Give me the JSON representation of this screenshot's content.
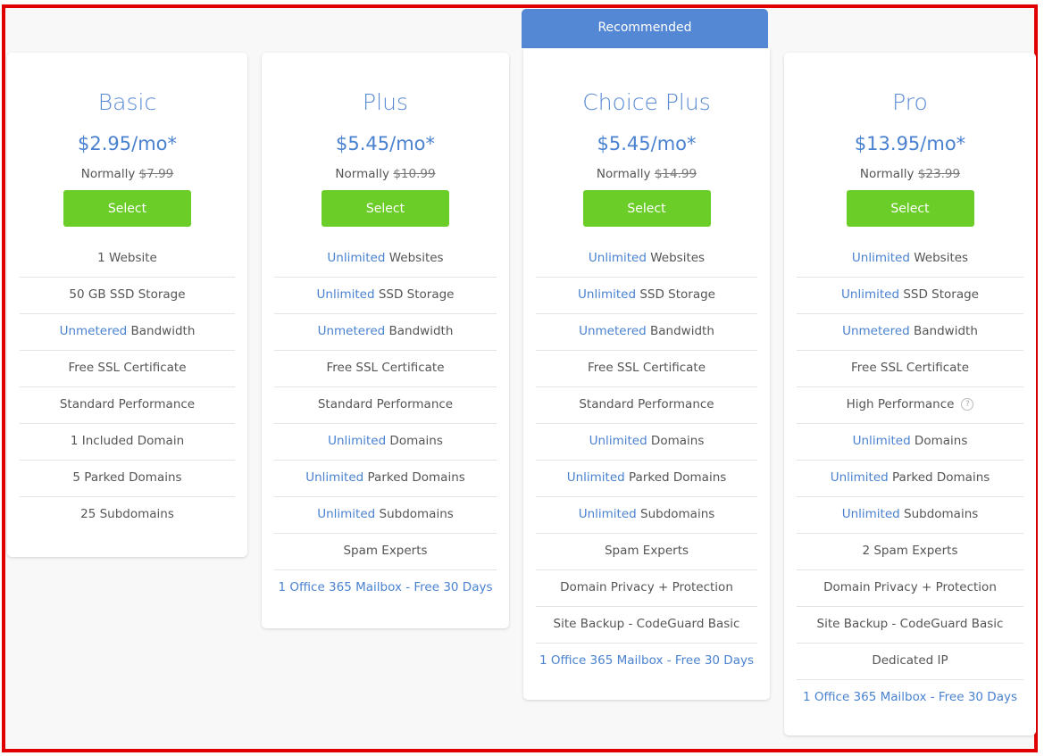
{
  "badge": "Recommended",
  "plans": [
    {
      "name": "Basic",
      "price": "$2.95/mo*",
      "normally_label": "Normally",
      "normal_price": "$7.99",
      "button": "Select",
      "features": [
        {
          "hl": "",
          "text": "1 Website"
        },
        {
          "hl": "",
          "text": "50 GB SSD Storage"
        },
        {
          "hl": "Unmetered",
          "text": " Bandwidth"
        },
        {
          "hl": "",
          "text": "Free SSL Certificate"
        },
        {
          "hl": "",
          "text": "Standard Performance"
        },
        {
          "hl": "",
          "text": "1 Included Domain"
        },
        {
          "hl": "",
          "text": "5 Parked Domains"
        },
        {
          "hl": "",
          "text": "25 Subdomains"
        }
      ]
    },
    {
      "name": "Plus",
      "price": "$5.45/mo*",
      "normally_label": "Normally",
      "normal_price": "$10.99",
      "button": "Select",
      "features": [
        {
          "hl": "Unlimited",
          "text": " Websites"
        },
        {
          "hl": "Unlimited",
          "text": " SSD Storage"
        },
        {
          "hl": "Unmetered",
          "text": " Bandwidth"
        },
        {
          "hl": "",
          "text": "Free SSL Certificate"
        },
        {
          "hl": "",
          "text": "Standard Performance"
        },
        {
          "hl": "Unlimited",
          "text": " Domains"
        },
        {
          "hl": "Unlimited",
          "text": " Parked Domains"
        },
        {
          "hl": "Unlimited",
          "text": " Subdomains"
        },
        {
          "hl": "",
          "text": "Spam Experts"
        },
        {
          "link": "1 Office 365 Mailbox - Free 30 Days"
        }
      ]
    },
    {
      "name": "Choice Plus",
      "price": "$5.45/mo*",
      "normally_label": "Normally",
      "normal_price": "$14.99",
      "button": "Select",
      "features": [
        {
          "hl": "Unlimited",
          "text": " Websites"
        },
        {
          "hl": "Unlimited",
          "text": " SSD Storage"
        },
        {
          "hl": "Unmetered",
          "text": " Bandwidth"
        },
        {
          "hl": "",
          "text": "Free SSL Certificate"
        },
        {
          "hl": "",
          "text": "Standard Performance"
        },
        {
          "hl": "Unlimited",
          "text": " Domains"
        },
        {
          "hl": "Unlimited",
          "text": " Parked Domains"
        },
        {
          "hl": "Unlimited",
          "text": " Subdomains"
        },
        {
          "hl": "",
          "text": "Spam Experts"
        },
        {
          "hl": "",
          "text": "Domain Privacy + Protection"
        },
        {
          "hl": "",
          "text": "Site Backup - CodeGuard Basic"
        },
        {
          "link": "1 Office 365 Mailbox - Free 30 Days"
        }
      ]
    },
    {
      "name": "Pro",
      "price": "$13.95/mo*",
      "normally_label": "Normally",
      "normal_price": "$23.99",
      "button": "Select",
      "features": [
        {
          "hl": "Unlimited",
          "text": " Websites"
        },
        {
          "hl": "Unlimited",
          "text": " SSD Storage"
        },
        {
          "hl": "Unmetered",
          "text": " Bandwidth"
        },
        {
          "hl": "",
          "text": "Free SSL Certificate"
        },
        {
          "hl": "",
          "text": "High Performance",
          "help": "?"
        },
        {
          "hl": "Unlimited",
          "text": " Domains"
        },
        {
          "hl": "Unlimited",
          "text": " Parked Domains"
        },
        {
          "hl": "Unlimited",
          "text": " Subdomains"
        },
        {
          "hl": "",
          "text": "2 Spam Experts"
        },
        {
          "hl": "",
          "text": "Domain Privacy + Protection"
        },
        {
          "hl": "",
          "text": "Site Backup - CodeGuard Basic"
        },
        {
          "hl": "",
          "text": "Dedicated IP"
        },
        {
          "link": "1 Office 365 Mailbox - Free 30 Days"
        }
      ]
    }
  ]
}
